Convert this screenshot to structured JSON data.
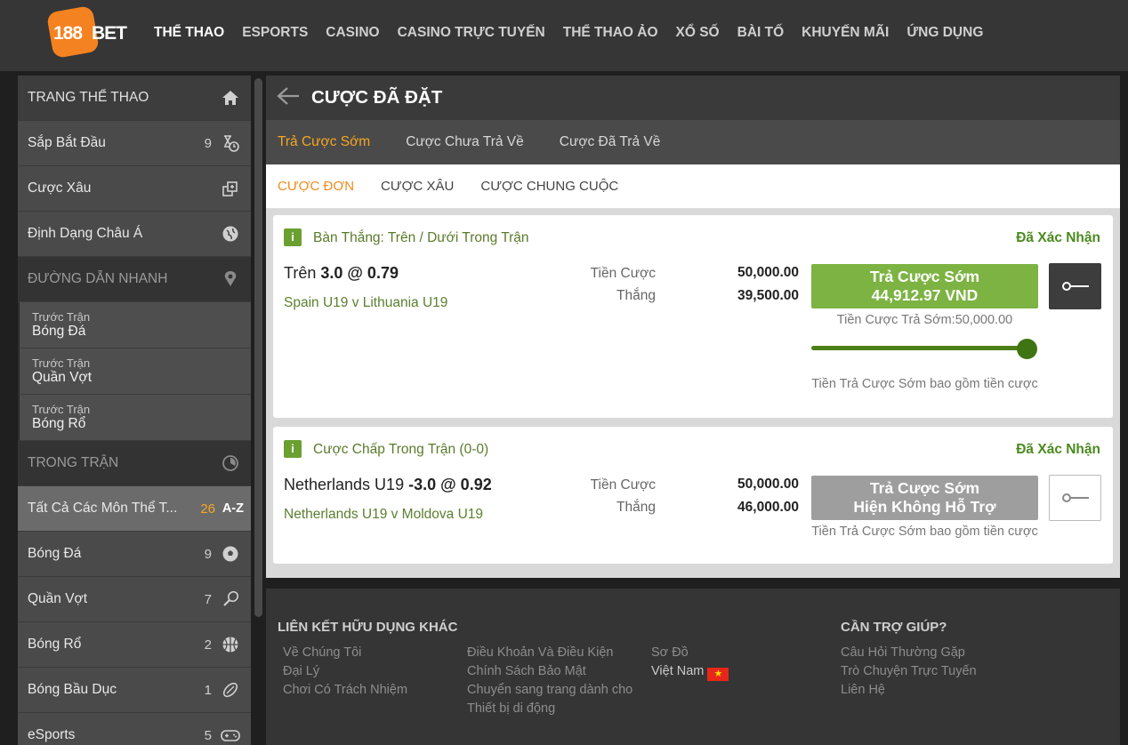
{
  "header": {
    "logo_num": "188",
    "logo_bet": "BET",
    "nav": [
      "THỂ THAO",
      "ESPORTS",
      "CASINO",
      "CASINO TRỰC TUYẾN",
      "THỂ THAO ẢO",
      "XỔ SỐ",
      "BÀI TỐ",
      "KHUYẾN MÃI",
      "ỨNG DỤNG"
    ]
  },
  "sidebar": {
    "home": "TRANG THỂ THAO",
    "starting_soon": {
      "label": "Sắp Bắt Đầu",
      "count": "9"
    },
    "parlay": "Cược Xâu",
    "asian_format": "Định Dạng Châu Á",
    "quick_links": "ĐƯỜNG DẪN NHANH",
    "links": [
      {
        "small": "Trước Trận",
        "big": "Bóng Đá"
      },
      {
        "small": "Trước Trận",
        "big": "Quần Vợt"
      },
      {
        "small": "Trước Trận",
        "big": "Bóng Rổ"
      }
    ],
    "in_play": "TRONG TRẬN",
    "all_sports": {
      "label": "Tất Cả Các Môn Thể T...",
      "count": "26",
      "sort": "A-Z"
    },
    "sports": [
      {
        "label": "Bóng Đá",
        "count": "9",
        "icon": "soccer-ball-icon"
      },
      {
        "label": "Quần Vợt",
        "count": "7",
        "icon": "tennis-icon"
      },
      {
        "label": "Bóng Rổ",
        "count": "2",
        "icon": "basketball-icon"
      },
      {
        "label": "Bóng Bầu Dục",
        "count": "1",
        "icon": "rugby-ball-icon"
      },
      {
        "label": "eSports",
        "count": "5",
        "icon": "gamepad-icon"
      }
    ]
  },
  "main": {
    "title": "CƯỢC ĐÃ ĐẶT",
    "tabs": [
      "Trả Cược Sớm",
      "Cược Chưa Trả Về",
      "Cược Đã Trả Về"
    ],
    "subtabs": [
      "CƯỢC ĐƠN",
      "CƯỢC XÂU",
      "CƯỢC CHUNG CUỘC"
    ],
    "bets": [
      {
        "market": "Bàn Thắng: Trên / Dưới Trong Trận",
        "status": "Đã Xác Nhận",
        "selection": "Trên",
        "selection_bold": "3.0 @ 0.79",
        "match": "Spain U19 v Lithuania U19",
        "stake_label": "Tiền Cược",
        "stake": "50,000.00",
        "win_label": "Thắng",
        "win": "39,500.00",
        "cashout_title": "Trả Cược Sớm",
        "cashout_value": "44,912.97 VND",
        "cashout_stake": "Tiền Cược Trả Sớm:50,000.00",
        "slider_fraction": 1.0,
        "note": "Tiền Trả Cược Sớm bao gồm tiền cược"
      },
      {
        "market": "Cược Chấp Trong Trận (0-0)",
        "status": "Đã Xác Nhận",
        "selection": "Netherlands U19",
        "selection_bold": "-3.0 @ 0.92",
        "match": "Netherlands U19 v Moldova U19",
        "stake_label": "Tiền Cược",
        "stake": "50,000.00",
        "win_label": "Thắng",
        "win": "46,000.00",
        "cashout_title": "Trả Cược Sớm",
        "cashout_value": "Hiện Không Hỗ Trợ",
        "note": "Tiền Trả Cược Sớm bao gồm tiền cược"
      }
    ]
  },
  "footer": {
    "links_title": "LIÊN KẾT HỮU DỤNG KHÁC",
    "col1": [
      "Về Chúng Tôi",
      "Đại Lý",
      "Chơi Có Trách Nhiệm"
    ],
    "col2": [
      "Điều Khoản Và Điều Kiện",
      "Chính Sách Bảo Mật",
      "Chuyển sang trang dành cho",
      "Thiết bị di động"
    ],
    "col3_sitemap": "Sơ Đồ",
    "col3_country": "Việt Nam",
    "help_title": "CẦN TRỢ GIÚP?",
    "help": [
      "Câu Hỏi Thường Gặp",
      "Trò Chuyện Trực Tuyến",
      "Liên Hệ"
    ]
  },
  "colors": {
    "accent": "#f5a623",
    "green": "#7cb342",
    "status_green": "#4c8a1f"
  }
}
